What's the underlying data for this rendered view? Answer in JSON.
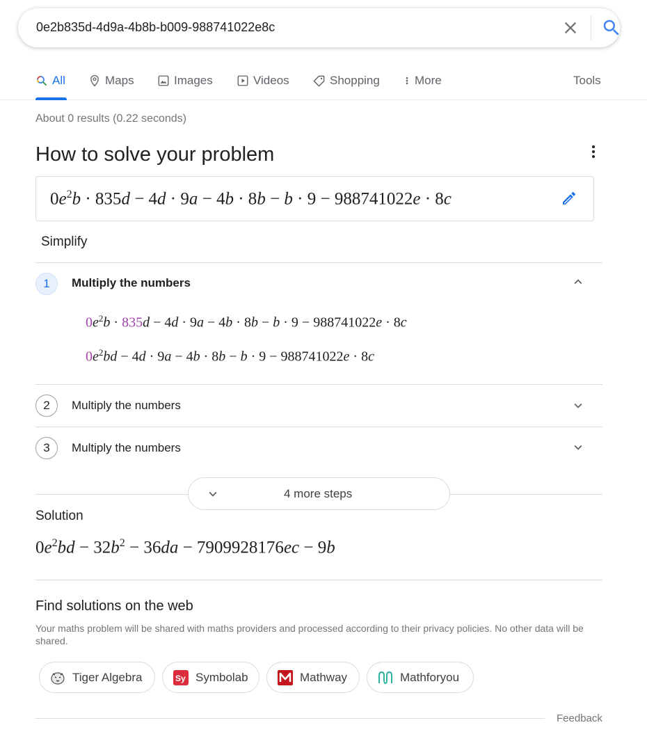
{
  "search": {
    "query": "0e2b835d-4d9a-4b8b-b009-988741022e8c"
  },
  "tabs": [
    {
      "label": "All",
      "icon": "search-icon"
    },
    {
      "label": "Maps",
      "icon": "map-pin-icon"
    },
    {
      "label": "Images",
      "icon": "image-icon"
    },
    {
      "label": "Videos",
      "icon": "video-icon"
    },
    {
      "label": "Shopping",
      "icon": "tag-icon"
    },
    {
      "label": "More",
      "icon": "more-vert-icon"
    }
  ],
  "tools_label": "Tools",
  "result_stats": "About 0 results (0.22 seconds)",
  "solver": {
    "title": "How to solve your problem",
    "problem_expr": "0e²b · 835d − 4d · 9a − 4b · 8b − b · 9 − 988741022e · 8c",
    "mode": "Simplify",
    "steps": [
      {
        "number": "1",
        "title": "Multiply the numbers",
        "expanded": true,
        "line1": "0e²b · 835d − 4d · 9a − 4b · 8b − b · 9 − 988741022e · 8c",
        "line2": "0e²bd − 4d · 9a − 4b · 8b − b · 9 − 988741022e · 8c"
      },
      {
        "number": "2",
        "title": "Multiply the numbers",
        "expanded": false
      },
      {
        "number": "3",
        "title": "Multiply the numbers",
        "expanded": false
      }
    ],
    "more_steps_label": "4 more steps",
    "solution_label": "Solution",
    "solution_expr": "0e²bd − 32b² − 36da − 7909928176ec − 9b"
  },
  "web": {
    "title": "Find solutions on the web",
    "note": "Your maths problem will be shared with maths providers and processed according to their privacy policies. No other data will be shared.",
    "providers": [
      {
        "name": "Tiger Algebra",
        "icon": "tiger-algebra-logo"
      },
      {
        "name": "Symbolab",
        "icon": "symbolab-logo"
      },
      {
        "name": "Mathway",
        "icon": "mathway-logo"
      },
      {
        "name": "Mathforyou",
        "icon": "mathforyou-logo"
      }
    ]
  },
  "feedback_label": "Feedback",
  "colors": {
    "accent": "#1a73e8",
    "highlight": "#a142a8",
    "symbolab": "#dc2d3c",
    "mathway": "#c4161c",
    "mathforyou": "#2bb3a0"
  }
}
